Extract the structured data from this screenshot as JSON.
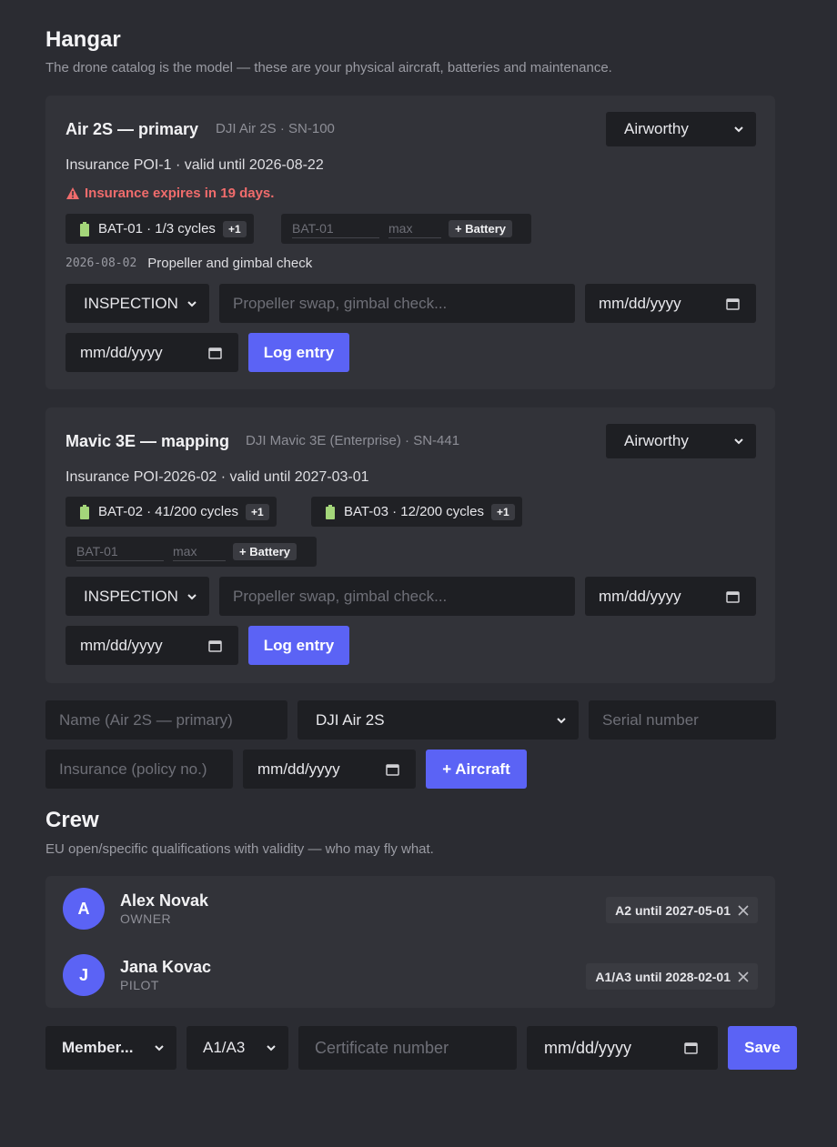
{
  "hangar": {
    "title": "Hangar",
    "subtitle": "The drone catalog is the model — these are your physical aircraft, batteries and maintenance."
  },
  "aircraft": [
    {
      "name": "Air 2S — primary",
      "model_serial": "DJI Air 2S · SN-100",
      "status": "Airworthy",
      "insurance": "Insurance POI-1 · valid until 2026-08-22",
      "warning": "Insurance expires in 19 days.",
      "batteries": [
        {
          "label": "BAT-01 · 1/3 cycles",
          "action": "+1"
        }
      ],
      "battery_form": {
        "id_placeholder": "BAT-01",
        "max_placeholder": "max",
        "add_label": "+ Battery"
      },
      "log": [
        {
          "date": "2026-08-02",
          "text": "Propeller and gimbal check"
        }
      ],
      "entry_form": {
        "type": "INSPECTION",
        "note_placeholder": "Propeller swap, gimbal check...",
        "date1": "mm/dd/yyyy",
        "date2": "mm/dd/yyyy",
        "submit": "Log entry"
      }
    },
    {
      "name": "Mavic 3E — mapping",
      "model_serial": "DJI Mavic 3E (Enterprise) · SN-441",
      "status": "Airworthy",
      "insurance": "Insurance POI-2026-02 · valid until 2027-03-01",
      "batteries": [
        {
          "label": "BAT-02 · 41/200 cycles",
          "action": "+1"
        },
        {
          "label": "BAT-03 · 12/200 cycles",
          "action": "+1"
        }
      ],
      "battery_form": {
        "id_placeholder": "BAT-01",
        "max_placeholder": "max",
        "add_label": "+ Battery"
      },
      "entry_form": {
        "type": "INSPECTION",
        "note_placeholder": "Propeller swap, gimbal check...",
        "date1": "mm/dd/yyyy",
        "date2": "mm/dd/yyyy",
        "submit": "Log entry"
      }
    }
  ],
  "add_aircraft": {
    "name_placeholder": "Name (Air 2S — primary)",
    "model": "DJI Air 2S",
    "serial_placeholder": "Serial number",
    "insurance_placeholder": "Insurance (policy no.)",
    "date": "mm/dd/yyyy",
    "submit": "+ Aircraft"
  },
  "crew": {
    "title": "Crew",
    "subtitle": "EU open/specific qualifications with validity — who may fly what.",
    "members": [
      {
        "initial": "A",
        "name": "Alex Novak",
        "role": "OWNER",
        "qualification": "A2 until 2027-05-01"
      },
      {
        "initial": "J",
        "name": "Jana Kovac",
        "role": "PILOT",
        "qualification": "A1/A3 until 2028-02-01"
      }
    ],
    "form": {
      "member": "Member...",
      "category": "A1/A3",
      "cert_placeholder": "Certificate number",
      "date": "mm/dd/yyyy",
      "submit": "Save"
    }
  },
  "colors": {
    "accent": "#5b63f5",
    "warning": "#f06c6c",
    "background": "#2b2c32",
    "card": "#323339",
    "field": "#1e1f23"
  },
  "icons": {
    "chevron": "chevron-down-icon",
    "calendar": "calendar-icon",
    "battery": "battery-icon",
    "warning": "warning-icon",
    "close": "close-icon"
  }
}
